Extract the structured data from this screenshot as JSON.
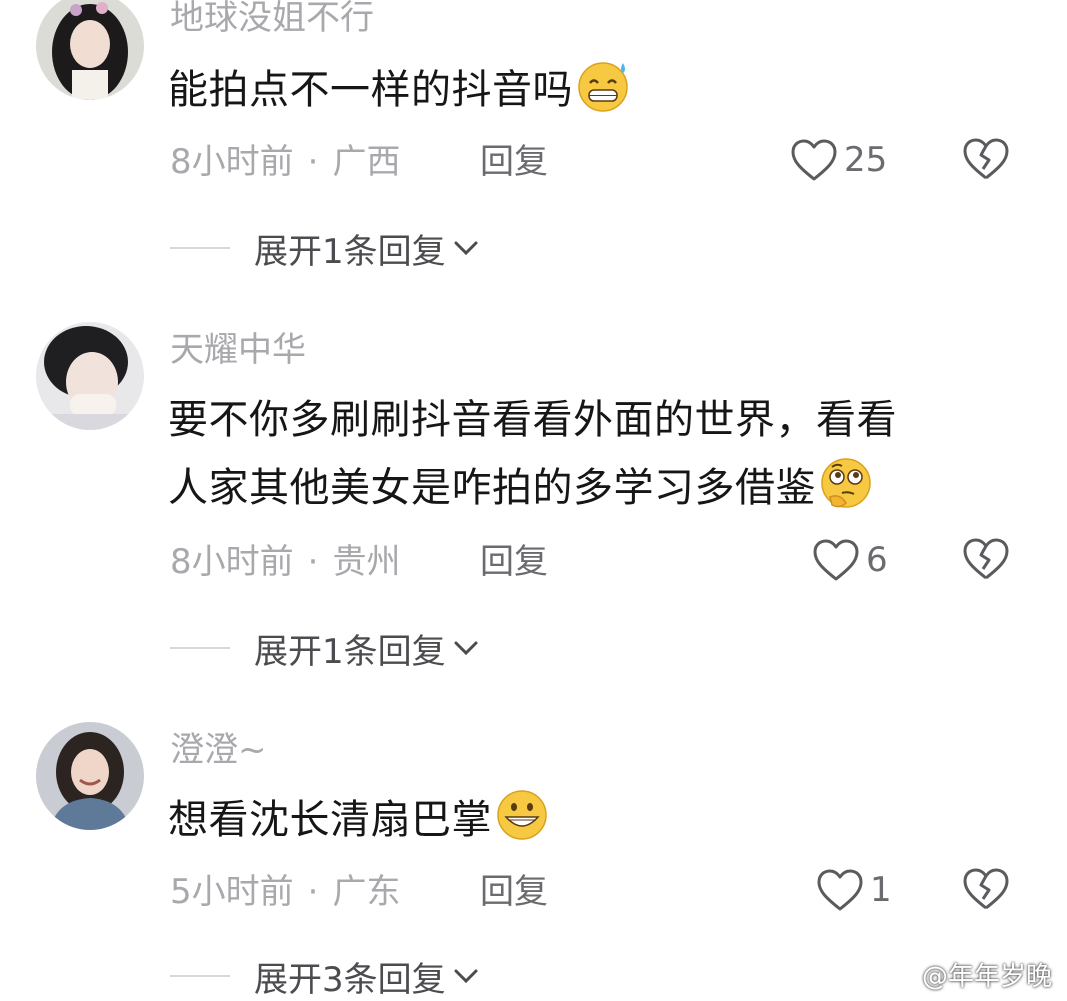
{
  "comments": [
    {
      "username": "地球没姐不行",
      "text": "能拍点不一样的抖音吗",
      "emoji": "grin-sweat-emoji",
      "time": "8小时前",
      "location": "广西",
      "reply_label": "回复",
      "likes": "25",
      "expand_label": "展开1条回复"
    },
    {
      "username": "天耀中华",
      "text_line1": "要不你多刷刷抖音看看外面的世界，看看",
      "text_line2": "人家其他美女是咋拍的多学习多借鉴",
      "emoji": "thinking-emoji",
      "time": "8小时前",
      "location": "贵州",
      "reply_label": "回复",
      "likes": "6",
      "expand_label": "展开1条回复"
    },
    {
      "username": "澄澄~",
      "text": "想看沈长清扇巴掌",
      "emoji": "grin-emoji",
      "time": "5小时前",
      "location": "广东",
      "reply_label": "回复",
      "likes": "1",
      "expand_label": "展开3条回复"
    }
  ],
  "meta_separator": "·",
  "watermark": "@年年岁晚",
  "colors": {
    "username": "#a9a9ad",
    "text": "#161616",
    "secondary": "#6b6b6f",
    "emoji": "#f7c842"
  }
}
